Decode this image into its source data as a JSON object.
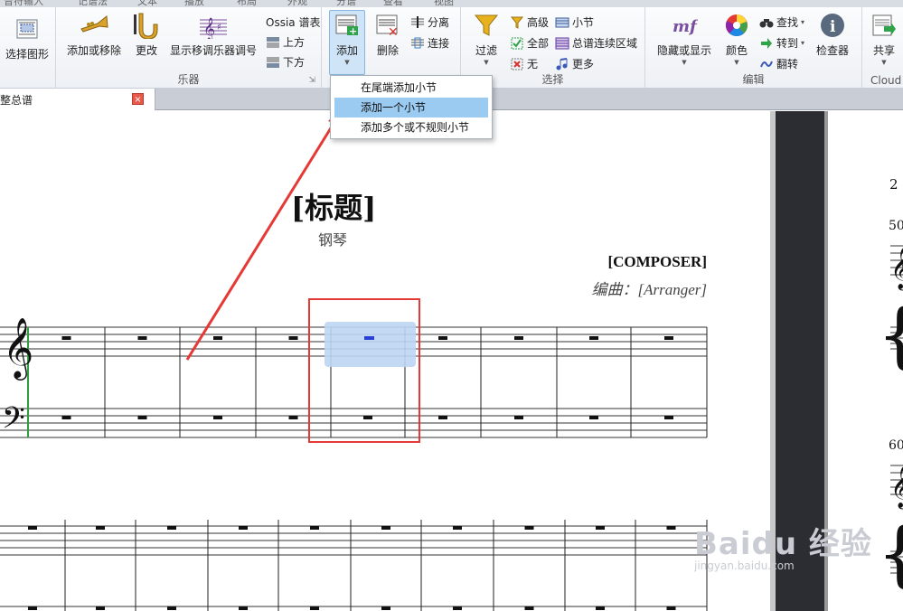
{
  "ribbon_tabs": [
    "音符输入",
    "记谱法",
    "文本",
    "播放",
    "布局",
    "外观",
    "分谱",
    "查看",
    "视图"
  ],
  "groups": {
    "select_graphic": {
      "label": "选择图形"
    },
    "instruments": {
      "label": "乐器",
      "add_remove": "添加或移除",
      "change": "更改",
      "show_transpose": "显示移调乐器调号",
      "ossia": "Ossia 谱表",
      "above": "上方",
      "below": "下方"
    },
    "bars": {
      "add": "添加",
      "delete": "删除",
      "split": "分离",
      "join": "连接"
    },
    "select": {
      "label": "选择",
      "filter": "过滤",
      "advanced": "高级",
      "all": "全部",
      "none": "无",
      "bar": "小节",
      "system_passage": "总谱连续区域",
      "more": "更多"
    },
    "edit": {
      "label": "编辑",
      "hide_show": "隐藏或显示",
      "color": "颜色",
      "find": "查找",
      "goto": "转到",
      "flip": "翻转",
      "inspector": "检查器"
    },
    "share": {
      "label": "Cloud",
      "share": "共享"
    }
  },
  "dropdown": {
    "items": [
      "在尾端添加小节",
      "添加一个小节",
      "添加多个或不规则小节"
    ],
    "highlighted_index": 1
  },
  "document_tab": {
    "title": "整总谱",
    "close": "×"
  },
  "score": {
    "title": "[标题]",
    "instrument": "钢琴",
    "composer": "[COMPOSER]",
    "arranger": "编曲：[Arranger]"
  },
  "page2": {
    "page_number": "2",
    "bar_50": "50",
    "bar_60": "60"
  },
  "watermark": {
    "brand": "Baidu 经验",
    "url": "jingyan.baidu.com"
  },
  "colors": {
    "selection": "#bcd5f3",
    "highlight_box": "#e53935",
    "arrow": "#e53935",
    "rest_selected": "#2a3fd6",
    "barline_green": "#2e9e3e"
  }
}
